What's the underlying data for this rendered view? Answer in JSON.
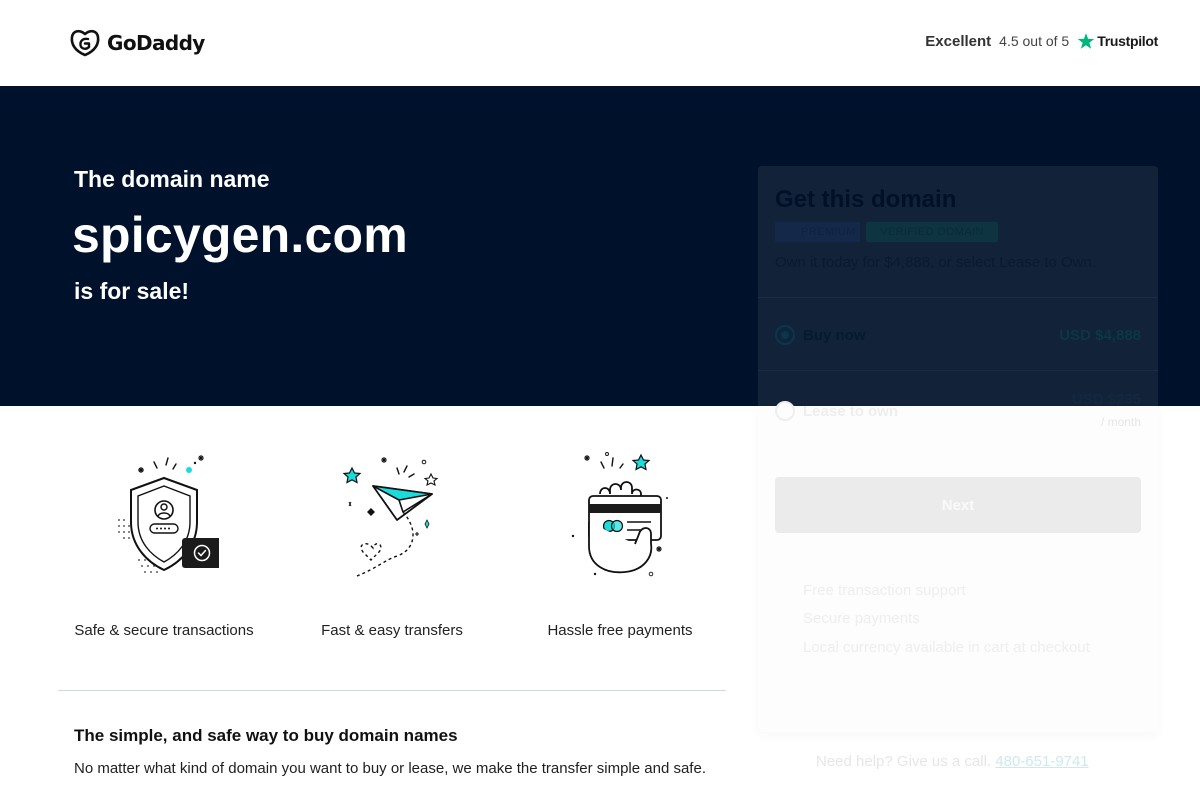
{
  "header": {
    "brand": "GoDaddy",
    "logo_icon": "godaddy-logo-icon",
    "rating_word": "Excellent",
    "rating_score": "4.5 out of 5",
    "rating_brand": "Trustpilot",
    "rating_icon": "star-icon"
  },
  "hero": {
    "pre": "The domain name",
    "domain": "spicygen.com",
    "post": "is for sale!"
  },
  "card": {
    "title": "Get this domain",
    "badges": [
      "PREMIUM",
      "VERIFIED DOMAIN"
    ],
    "description": "Own it today for $4,888, or select Lease to Own.",
    "options": [
      {
        "label": "Buy now",
        "price": "USD $4,888",
        "selected": true
      },
      {
        "label": "Lease to own",
        "price": "USD $235",
        "suffix": "/ month",
        "selected": false
      }
    ],
    "next_label": "Next",
    "benefits": [
      "Free transaction support",
      "Secure payments",
      "Local currency available in cart at checkout"
    ]
  },
  "help": {
    "text": "Need help? Give us a call.",
    "phone": "480-651-9741"
  },
  "features": [
    {
      "label": "Safe & secure transactions",
      "icon": "shield-user-icon"
    },
    {
      "label": "Fast & easy transfers",
      "icon": "paper-plane-icon"
    },
    {
      "label": "Hassle free payments",
      "icon": "hand-card-icon"
    }
  ],
  "why": {
    "title": "The simple, and safe way to buy domain names",
    "body": "No matter what kind of domain you want to buy or lease, we make the transfer simple and safe."
  },
  "colors": {
    "hero_bg": "#00112c",
    "accent_teal": "#1bdbdb",
    "text_dark": "#111111"
  }
}
